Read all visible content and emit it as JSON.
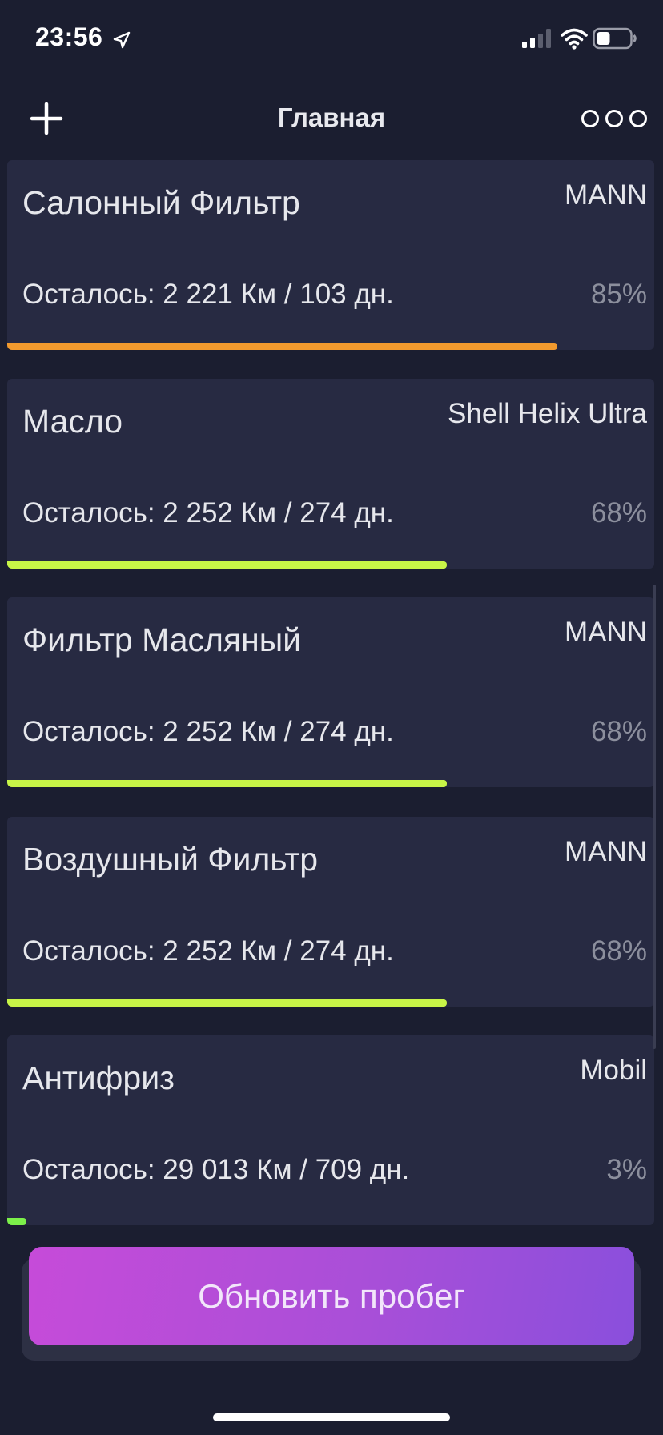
{
  "status_bar": {
    "time": "23:56",
    "icons": [
      "location-arrow-icon",
      "cellular-signal-icon",
      "wifi-icon",
      "battery-icon"
    ]
  },
  "nav": {
    "title": "Главная",
    "left_icon": "plus-icon",
    "right_icon": "more-dots-icon"
  },
  "items": [
    {
      "title": "Салонный Фильтр",
      "brand": "MANN",
      "remaining": "Осталось: 2 221 Км / 103 дн.",
      "percent": "85%",
      "fill": 0.85,
      "color": "#f29a2e"
    },
    {
      "title": "Масло",
      "brand": "Shell Helix Ultra",
      "remaining": "Осталось: 2 252 Км / 274 дн.",
      "percent": "68%",
      "fill": 0.68,
      "color": "#c8f547"
    },
    {
      "title": "Фильтр Масляный",
      "brand": "MANN",
      "remaining": "Осталось: 2 252 Км / 274 дн.",
      "percent": "68%",
      "fill": 0.68,
      "color": "#c8f547"
    },
    {
      "title": "Воздушный Фильтр",
      "brand": "MANN",
      "remaining": "Осталось: 2 252 Км / 274 дн.",
      "percent": "68%",
      "fill": 0.68,
      "color": "#c8f547"
    },
    {
      "title": "Антифриз",
      "brand": "Mobil",
      "remaining": "Осталось: 29 013 Км / 709 дн.",
      "percent": "3%",
      "fill": 0.03,
      "color": "#7cf04a"
    }
  ],
  "update_button": {
    "label": "Обновить пробег"
  },
  "colors": {
    "background": "#1b1e30",
    "card": "#272a42",
    "button_gradient_start": "#c64bd9",
    "button_gradient_end": "#8a4fdc"
  }
}
